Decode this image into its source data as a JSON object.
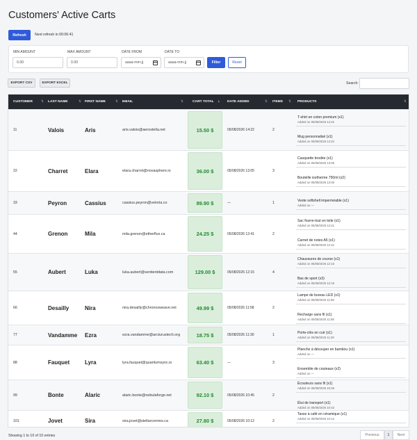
{
  "page": {
    "title": "Customers' Active Carts"
  },
  "toolbar": {
    "refresh_label": "Refresh",
    "next_refresh": "Next refresh in 00:06:41"
  },
  "filters": {
    "min_amount_label": "MIN AMOUNT",
    "min_amount_value": "0.00",
    "max_amount_label": "MAX AMOUNT",
    "max_amount_value": "0.00",
    "date_from_label": "DATE FROM",
    "date_from_placeholder": "aaaa-mm-jj",
    "date_to_label": "DATE TO",
    "date_to_placeholder": "aaaa-mm-jj",
    "filter_label": "Filter",
    "reset_label": "Reset"
  },
  "exports": {
    "csv_label": "EXPORT CSV",
    "excel_label": "EXPORT EXCEL"
  },
  "search": {
    "label": "Search:",
    "value": ""
  },
  "table": {
    "headers": [
      "CUSTOMER",
      "LAST NAME",
      "FIRST NAME",
      "EMAIL",
      "CART TOTAL",
      "DATE ADDED",
      "ITEMS",
      "PRODUCTS"
    ],
    "rows": [
      {
        "id": "11",
        "last": "Valois",
        "first": "Aris",
        "email": "aris.valois@aerostella.net",
        "total": "15.50 $",
        "date": "05/08/2026 14:22",
        "items": "2",
        "products": [
          {
            "name": "T-shirt en coton premium (x1)",
            "added": "Added on 05/08/2026 14:22"
          },
          {
            "name": "Mug personnalisé (x1)",
            "added": "Added on 05/08/2026 14:22"
          }
        ]
      },
      {
        "id": "22",
        "last": "Charret",
        "first": "Elara",
        "email": "elara.charret@novasphere.io",
        "total": "36.00 $",
        "date": "05/08/2026 13:05",
        "items": "3",
        "products": [
          {
            "name": "Casquette brodée (x1)",
            "added": "Added on 05/08/2026 13:05"
          },
          {
            "name": "Bouteille isotherme 750ml (x2)",
            "added": "Added on 05/08/2026 13:05"
          }
        ]
      },
      {
        "id": "33",
        "last": "Peyron",
        "first": "Cassius",
        "email": "cassius.peyron@veloria.co",
        "total": "89.90 $",
        "date": "—",
        "items": "1",
        "products": [
          {
            "name": "Veste softshell imperméable (x1)",
            "added": "Added on —"
          }
        ]
      },
      {
        "id": "44",
        "last": "Grenon",
        "first": "Mila",
        "email": "mila.grenon@etherflux.ca",
        "total": "24.25 $",
        "date": "05/08/2026 12:41",
        "items": "2",
        "products": [
          {
            "name": "Sac fourre-tout en toile (x1)",
            "added": "Added on 05/08/2026 12:41"
          },
          {
            "name": "Carnet de notes A5 (x1)",
            "added": "Added on 05/08/2026 12:41"
          }
        ]
      },
      {
        "id": "55",
        "last": "Aubert",
        "first": "Luka",
        "email": "luka.aubert@sentientdata.com",
        "total": "129.00 $",
        "date": "05/08/2026 12:15",
        "items": "4",
        "products": [
          {
            "name": "Chaussures de course (x1)",
            "added": "Added on 05/08/2026 12:15"
          },
          {
            "name": "Bas de sport (x3)",
            "added": "Added on 05/08/2026 12:15"
          }
        ]
      },
      {
        "id": "66",
        "last": "Desailly",
        "first": "Nira",
        "email": "nira.desailly@chronosweave.net",
        "total": "49.99 $",
        "date": "05/08/2026 11:58",
        "items": "2",
        "products": [
          {
            "name": "Lampe de bureau LED (x1)",
            "added": "Added on 05/08/2026 11:58"
          },
          {
            "name": "Recharge sans fil (x1)",
            "added": "Added on 05/08/2026 11:58"
          }
        ]
      },
      {
        "id": "77",
        "last": "Vandamme",
        "first": "Ezra",
        "email": "ezra.vandamme@arcturustech.org",
        "total": "18.75 $",
        "date": "05/08/2026 11:30",
        "items": "1",
        "products": [
          {
            "name": "Porte-clés en cuir (x1)",
            "added": "Added on 05/08/2026 11:30"
          }
        ]
      },
      {
        "id": "88",
        "last": "Fauquet",
        "first": "Lyra",
        "email": "lyra.fauquet@quantumsync.io",
        "total": "63.40 $",
        "date": "—",
        "items": "3",
        "products": [
          {
            "name": "Planche à découper en bambou (x1)",
            "added": "Added on —"
          },
          {
            "name": "Ensemble de couteaux (x2)",
            "added": "Added on —"
          }
        ]
      },
      {
        "id": "99",
        "last": "Bonte",
        "first": "Alaric",
        "email": "alaric.bonte@nebulaforge.net",
        "total": "92.10 $",
        "date": "05/08/2026 10:45",
        "items": "2",
        "products": [
          {
            "name": "Écouteurs sans fil (x1)",
            "added": "Added on 05/08/2026 10:45"
          },
          {
            "name": "Étui de transport (x1)",
            "added": "Added on 05/08/2026 10:43"
          }
        ]
      },
      {
        "id": "101",
        "last": "Jovet",
        "first": "Sira",
        "email": "sira.jovet@stellarcomms.ca",
        "total": "27.80 $",
        "date": "05/08/2026 10:12",
        "items": "2",
        "products": [
          {
            "name": "Tasse à café en céramique (x1)",
            "added": "Added on 05/08/2026 10:12"
          },
          {
            "name": "Thé en vrac – Assortiment (x1)",
            "added": "Added on 05/08/2026 10:12"
          }
        ]
      }
    ]
  },
  "footer": {
    "info": "Showing 1 to 10 of 10 entries",
    "previous": "Previous",
    "page": "1",
    "next": "Next"
  },
  "colors": {
    "accent": "#2f5bd9",
    "header_bg": "#262a30",
    "total_bg": "#dbeedc",
    "total_text": "#1f8a2e"
  }
}
